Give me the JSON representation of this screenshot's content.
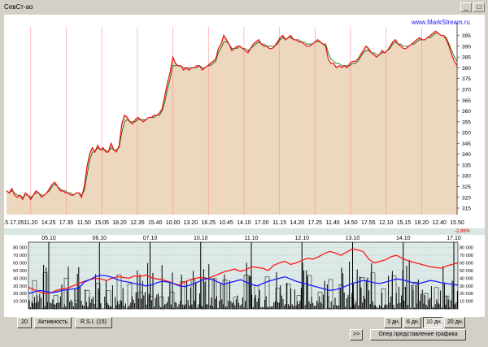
{
  "window": {
    "title": "СевСт-ао"
  },
  "watermark": "www.MarkStream.ru",
  "change_label": "-2,86%",
  "colors": {
    "price_line": "#e8191a",
    "ma_line": "#006400",
    "price_fill": "#edd7bf",
    "volume_bars": "#000000",
    "activity_red": "#ff1a1a",
    "activity_blue": "#1a1aff",
    "day_separator": "#ff9090",
    "background": "#d4d0c8"
  },
  "chart_data": [
    {
      "type": "line",
      "description_series": "price",
      "x_tick_labels": [
        "15.17.05",
        "11.20",
        "14.25",
        "17.35",
        "11.50",
        "15.05",
        "18.20",
        "12.35",
        "15.40",
        "10.00",
        "13.20",
        "16.25",
        "10.45",
        "14.10",
        "17.00",
        "11.15",
        "14.20",
        "17.25",
        "11.40",
        "14.50",
        "17.55",
        "12.10",
        "15.15",
        "18.20",
        "12.40",
        "15.50"
      ],
      "y_tick_labels": [
        "395",
        "390",
        "385",
        "380",
        "375",
        "370",
        "365",
        "360",
        "355",
        "350",
        "345",
        "340",
        "335",
        "330",
        "325",
        "320",
        "315"
      ],
      "ylim": [
        312,
        399
      ],
      "y_axis_position": "right",
      "series": [
        {
          "values": [
            323,
            322,
            324,
            321,
            320,
            321,
            319,
            322,
            321,
            319,
            321,
            323,
            322,
            320,
            321,
            322,
            324,
            326,
            327,
            325,
            323,
            323,
            322,
            322,
            321,
            321,
            322,
            322,
            320,
            325,
            334,
            340,
            343,
            341,
            344,
            342,
            343,
            341,
            341,
            345,
            342,
            341,
            344,
            354,
            358,
            357,
            355,
            354,
            356,
            357,
            356,
            355,
            356,
            357,
            357,
            358,
            358,
            359,
            361,
            367,
            373,
            378,
            385,
            382,
            381,
            381,
            379,
            380,
            379,
            380,
            380,
            381,
            381,
            379,
            380,
            381,
            382,
            383,
            384,
            389,
            391,
            395,
            393,
            391,
            388,
            389,
            390,
            390,
            389,
            388,
            387,
            389,
            391,
            392,
            393,
            391,
            390,
            390,
            389,
            389,
            390,
            392,
            394,
            395,
            393,
            394,
            395,
            393,
            393,
            392,
            392,
            391,
            390,
            390,
            391,
            392,
            393,
            392,
            391,
            390,
            384,
            382,
            382,
            380,
            381,
            380,
            381,
            380,
            382,
            383,
            383,
            384,
            386,
            388,
            390,
            389,
            387,
            386,
            385,
            386,
            388,
            387,
            388,
            390,
            392,
            393,
            391,
            390,
            389,
            389,
            390,
            391,
            392,
            393,
            394,
            393,
            393,
            394,
            395,
            396,
            397,
            396,
            395,
            395,
            393,
            390,
            386,
            383,
            381
          ]
        },
        {
          "values": [
            323,
            322,
            323,
            322,
            321,
            321,
            320,
            321,
            321,
            320,
            321,
            322,
            322,
            321,
            321,
            322,
            323,
            325,
            326,
            325,
            324,
            323,
            323,
            322,
            322,
            321,
            322,
            322,
            321,
            323,
            330,
            337,
            341,
            341,
            343,
            342,
            342,
            342,
            341,
            343,
            342,
            342,
            343,
            350,
            355,
            356,
            355,
            355,
            355,
            356,
            356,
            356,
            356,
            357,
            357,
            357,
            358,
            358,
            360,
            364,
            370,
            375,
            381,
            381,
            381,
            381,
            380,
            380,
            380,
            380,
            380,
            380,
            381,
            380,
            380,
            381,
            381,
            382,
            383,
            387,
            389,
            392,
            392,
            391,
            389,
            389,
            389,
            390,
            389,
            389,
            388,
            389,
            390,
            391,
            392,
            391,
            391,
            390,
            390,
            390,
            390,
            391,
            393,
            394,
            393,
            394,
            394,
            393,
            393,
            393,
            392,
            392,
            391,
            391,
            391,
            392,
            392,
            392,
            391,
            391,
            387,
            384,
            383,
            382,
            382,
            381,
            381,
            381,
            381,
            382,
            382,
            383,
            385,
            387,
            388,
            388,
            387,
            387,
            386,
            386,
            387,
            387,
            388,
            389,
            391,
            392,
            391,
            391,
            390,
            390,
            390,
            391,
            391,
            392,
            393,
            393,
            393,
            394,
            394,
            395,
            396,
            396,
            395,
            395,
            394,
            391,
            388,
            385,
            383
          ]
        }
      ]
    },
    {
      "type": "bar",
      "description_series": "volume with activity lines",
      "x_tick_labels": [
        "05.10",
        "06.10",
        "07.10",
        "10.10",
        "11.10",
        "12.10",
        "13.10",
        "14.10",
        "17.10"
      ],
      "y_tick_labels_left": [
        "80 000",
        "70 000",
        "60 000",
        "50 000",
        "40 000",
        "30 000",
        "20 000",
        "10 000"
      ],
      "y_tick_labels_right": [
        "80 000",
        "70 000",
        "60 000",
        "50 000",
        "40 000",
        "30 000",
        "20 000",
        "10 000"
      ],
      "ylim": [
        0,
        85000
      ],
      "series": [
        {
          "name_hint": "activity_red",
          "values": [
            28000,
            25000,
            22000,
            20000,
            21000,
            24000,
            26000,
            27000,
            30000,
            33000,
            36000,
            38000,
            40000,
            39000,
            37000,
            40000,
            42000,
            41000,
            40000,
            43000,
            42000,
            44000,
            41000,
            39000,
            38000,
            36000,
            33000,
            31000,
            35000,
            38000,
            40000,
            41000,
            39000,
            42000,
            45000,
            48000,
            50000,
            52000,
            49000,
            51000,
            55000,
            54000,
            53000,
            50000,
            57000,
            60000,
            62000,
            58000,
            60000,
            63000,
            66000,
            65000,
            68000,
            72000,
            75000,
            73000,
            70000,
            74000,
            78000,
            77000,
            75000,
            65000,
            60000,
            62000,
            64000,
            68000,
            70000,
            66000,
            63000,
            61000,
            59000,
            57000,
            55000,
            54000,
            53000,
            56000,
            58000,
            60000
          ]
        },
        {
          "name_hint": "activity_blue",
          "values": [
            20000,
            22000,
            24000,
            23000,
            21000,
            22000,
            24000,
            25000,
            26000,
            27000,
            35000,
            38000,
            42000,
            44000,
            43000,
            41000,
            38000,
            36000,
            35000,
            33000,
            32000,
            30000,
            31000,
            34000,
            36000,
            35000,
            33000,
            30000,
            29000,
            31000,
            34000,
            37000,
            40000,
            38000,
            35000,
            32000,
            34000,
            36000,
            38000,
            35000,
            32000,
            30000,
            33000,
            36000,
            38000,
            40000,
            42000,
            39000,
            36000,
            34000,
            32000,
            30000,
            28000,
            26000,
            24000,
            25000,
            27000,
            30000,
            33000,
            35000,
            37000,
            36000,
            34000,
            33000,
            35000,
            37000,
            39000,
            38000,
            36000,
            34000,
            33000,
            35000,
            37000,
            36000,
            34000,
            33000,
            32000,
            31000
          ]
        }
      ]
    }
  ],
  "buttons": {
    "period_value": "20",
    "activity": "Активность",
    "rsi": "R.S.I.",
    "rsi_period": "(15)",
    "forward": ">>",
    "days_3": "3 дн.",
    "days_6": "6 дн.",
    "days_10": "10 дн.",
    "days_20": "20 дн.",
    "oper_view": "Опер.представление графика"
  }
}
